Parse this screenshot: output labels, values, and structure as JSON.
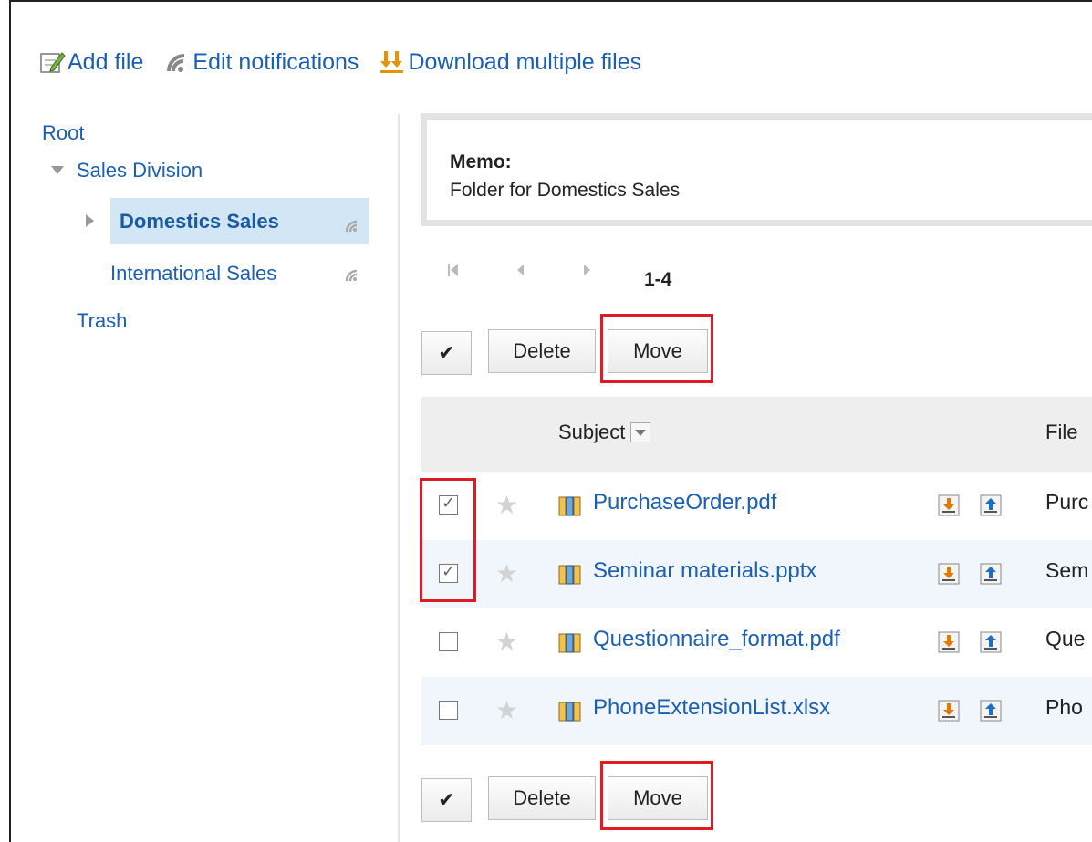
{
  "toolbar": {
    "add_file": "Add file",
    "edit_notifications": "Edit notifications",
    "download_multiple": "Download multiple files"
  },
  "tree": {
    "root": "Root",
    "sales_division": "Sales Division",
    "domestics_sales": "Domestics Sales",
    "international_sales": "International Sales",
    "trash": "Trash"
  },
  "memo": {
    "title": "Memo:",
    "text": "Folder for Domestics Sales"
  },
  "pager": {
    "range": "1-4"
  },
  "actions": {
    "delete": "Delete",
    "move": "Move",
    "check_all": "✔"
  },
  "table": {
    "header_subject": "Subject",
    "header_file": "File",
    "rows": [
      {
        "name": "PurchaseOrder.pdf",
        "file_col": "Purc",
        "checked": true
      },
      {
        "name": "Seminar materials.pptx",
        "file_col": "Sem",
        "checked": true
      },
      {
        "name": "Questionnaire_format.pdf",
        "file_col": "Que",
        "checked": false
      },
      {
        "name": "PhoneExtensionList.xlsx",
        "file_col": "Pho",
        "checked": false
      }
    ]
  },
  "colors": {
    "link": "#1a5fb4",
    "highlight": "#e01b24",
    "selected_bg": "#d3e6f6",
    "alt_row": "#f0f6fc"
  },
  "icons": [
    "add-file-icon",
    "rss-icon",
    "download-multiple-icon",
    "star-icon",
    "cabinet-icon",
    "download-icon",
    "upload-icon"
  ]
}
